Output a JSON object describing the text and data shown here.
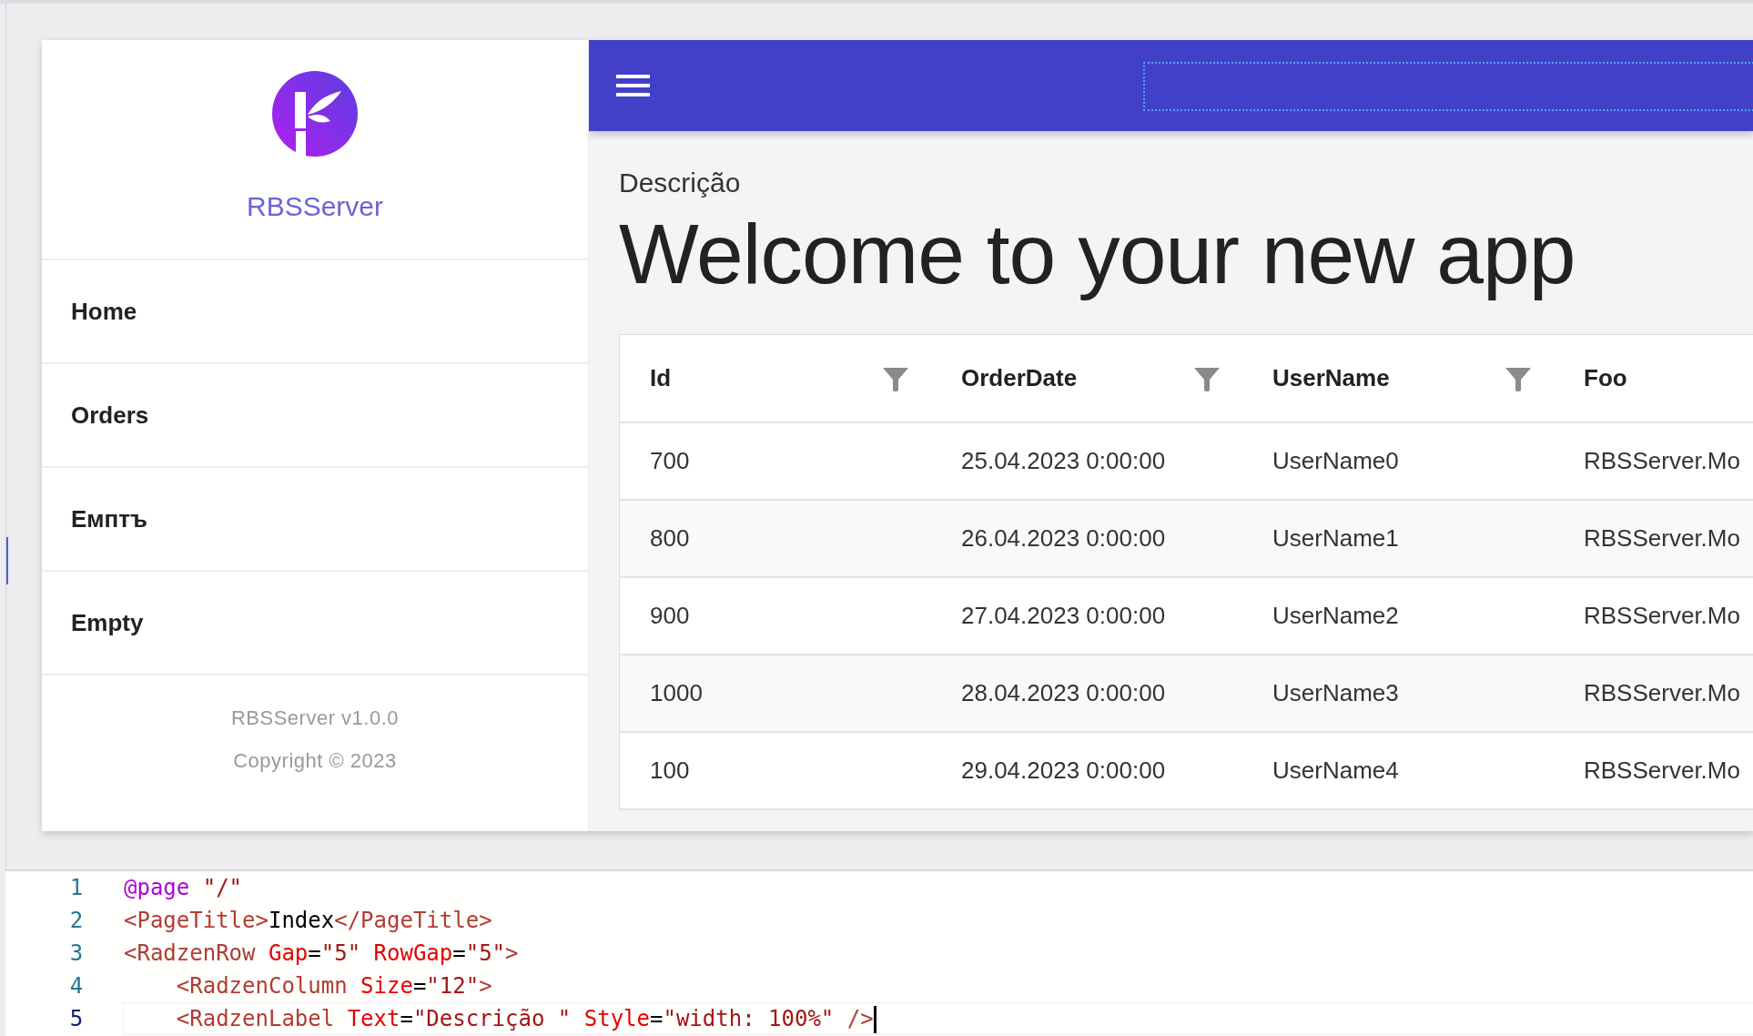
{
  "sidebar": {
    "app_name": "RBSServer",
    "nav_items": [
      {
        "label": "Home"
      },
      {
        "label": "Orders"
      },
      {
        "label": "Емптъ"
      },
      {
        "label": "Empty"
      }
    ],
    "footer": {
      "version": "RBSServer v1.0.0",
      "copyright": "Copyright © 2023"
    }
  },
  "content": {
    "label": "Descrição",
    "heading": "Welcome to your new app",
    "table": {
      "columns": [
        {
          "label": "Id"
        },
        {
          "label": "OrderDate"
        },
        {
          "label": "UserName"
        },
        {
          "label": "Foo"
        }
      ],
      "rows": [
        [
          "700",
          "25.04.2023 0:00:00",
          "UserName0",
          "RBSServer.Mo"
        ],
        [
          "800",
          "26.04.2023 0:00:00",
          "UserName1",
          "RBSServer.Mo"
        ],
        [
          "900",
          "27.04.2023 0:00:00",
          "UserName2",
          "RBSServer.Mo"
        ],
        [
          "1000",
          "28.04.2023 0:00:00",
          "UserName3",
          "RBSServer.Mo"
        ],
        [
          "100",
          "29.04.2023 0:00:00",
          "UserName4",
          "RBSServer.Mo"
        ]
      ]
    }
  },
  "editor": {
    "lines": [
      {
        "number": "1",
        "current": false,
        "tokens": [
          {
            "kind": "directive",
            "text": "@page"
          },
          {
            "kind": "value",
            "text": " \"/\""
          }
        ]
      },
      {
        "number": "2",
        "current": false,
        "tokens": [
          {
            "kind": "tag",
            "text": "<PageTitle>"
          },
          {
            "kind": "plain",
            "text": "Index"
          },
          {
            "kind": "tag",
            "text": "</PageTitle>"
          }
        ]
      },
      {
        "number": "3",
        "current": false,
        "tokens": [
          {
            "kind": "tag",
            "text": "<RadzenRow"
          },
          {
            "kind": "attr",
            "text": " Gap"
          },
          {
            "kind": "plain",
            "text": "="
          },
          {
            "kind": "value",
            "text": "\"5\""
          },
          {
            "kind": "attr",
            "text": " RowGap"
          },
          {
            "kind": "plain",
            "text": "="
          },
          {
            "kind": "value",
            "text": "\"5\""
          },
          {
            "kind": "tag",
            "text": ">"
          }
        ]
      },
      {
        "number": "4",
        "current": false,
        "tokens": [
          {
            "kind": "tag",
            "text": "    <RadzenColumn"
          },
          {
            "kind": "attr",
            "text": " Size"
          },
          {
            "kind": "plain",
            "text": "="
          },
          {
            "kind": "value",
            "text": "\"12\""
          },
          {
            "kind": "tag",
            "text": ">"
          }
        ]
      },
      {
        "number": "5",
        "current": true,
        "tokens": [
          {
            "kind": "tag",
            "text": "    <RadzenLabel"
          },
          {
            "kind": "attr",
            "text": " Text"
          },
          {
            "kind": "plain",
            "text": "="
          },
          {
            "kind": "value",
            "text": "\"Descrição \""
          },
          {
            "kind": "attr",
            "text": " Style"
          },
          {
            "kind": "plain",
            "text": "="
          },
          {
            "kind": "value",
            "text": "\"width: 100%\""
          },
          {
            "kind": "tag",
            "text": " />"
          }
        ]
      }
    ]
  }
}
